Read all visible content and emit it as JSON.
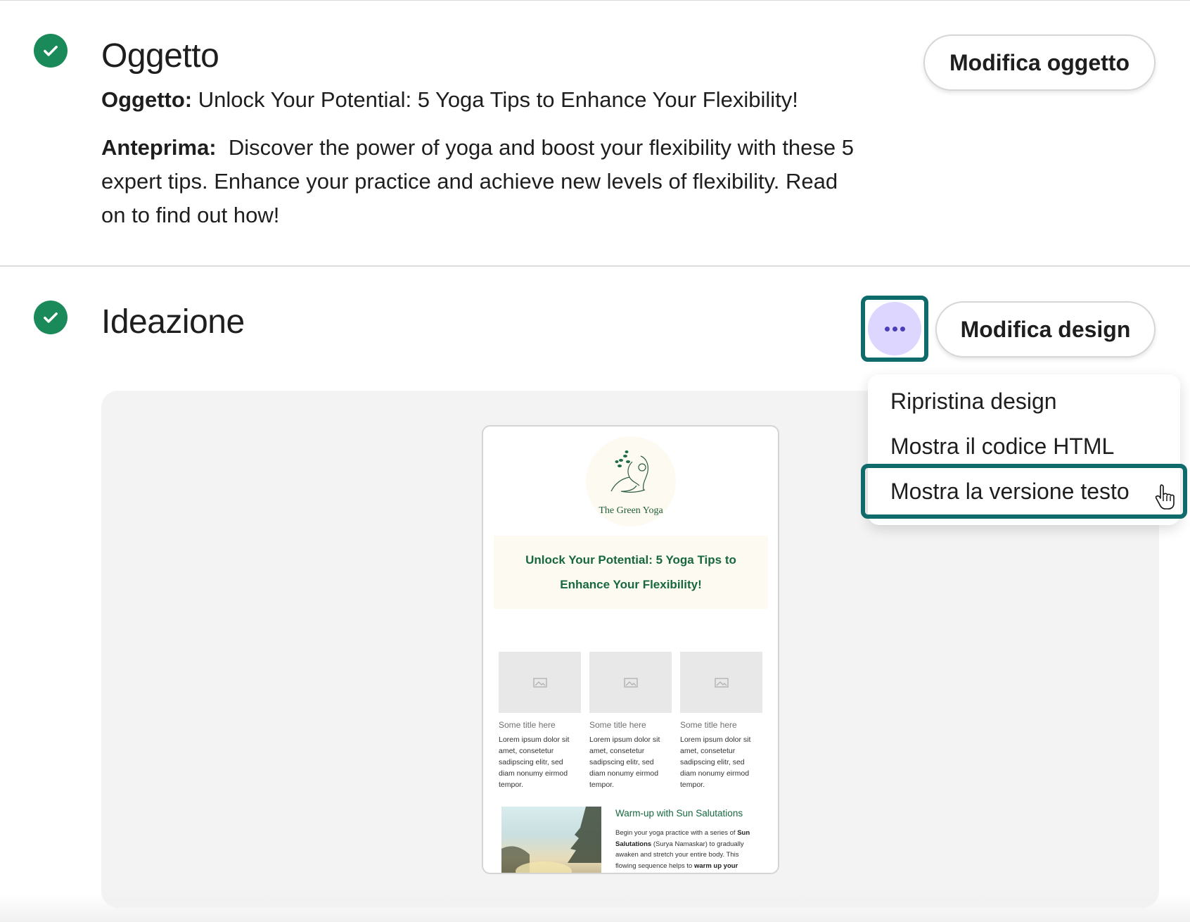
{
  "subject_section": {
    "heading": "Oggetto",
    "edit_button": "Modifica oggetto",
    "subject_label": "Oggetto:",
    "subject_text": "Unlock Your Potential: 5 Yoga Tips to Enhance Your Flexibility!",
    "preview_label": "Anteprima:",
    "preview_text": "Discover the power of yoga and boost your flexibility with these 5 expert tips. Enhance your practice and achieve new levels of flexibility. Read on to find out how!"
  },
  "design_section": {
    "heading": "Ideazione",
    "more_button_icon": "more-horizontal-icon",
    "edit_button": "Modifica design",
    "menu": {
      "items": [
        {
          "label": "Ripristina design"
        },
        {
          "label": "Mostra il codice HTML"
        },
        {
          "label": "Mostra la versione testo"
        }
      ],
      "highlighted_index": 2
    }
  },
  "email_preview": {
    "logo_text": "The Green Yoga",
    "hero_title": "Unlock Your Potential: 5 Yoga Tips to Enhance Your Flexibility!",
    "columns": [
      {
        "title": "Some title here",
        "body": "Lorem ipsum dolor sit amet, consetetur sadipscing elitr, sed diam nonumy eirmod tempor."
      },
      {
        "title": "Some title here",
        "body": "Lorem ipsum dolor sit amet, consetetur sadipscing elitr, sed diam nonumy eirmod tempor."
      },
      {
        "title": "Some title here",
        "body": "Lorem ipsum dolor sit amet, consetetur sadipscing elitr, sed diam nonumy eirmod tempor."
      }
    ],
    "article": {
      "title": "Warm-up with Sun Salutations",
      "body_1": "Begin your yoga practice with a series of ",
      "body_bold_1": "Sun Salutations",
      "body_2": " (Surya Namaskar) to gradually awaken and stretch your entire body. This flowing sequence helps to ",
      "body_bold_2": "warm up your"
    }
  },
  "colors": {
    "check_green": "#1b8a5a",
    "focus_ring": "#0f6b6b",
    "more_button_bg": "#ddd6ff",
    "email_green": "#17683f"
  }
}
